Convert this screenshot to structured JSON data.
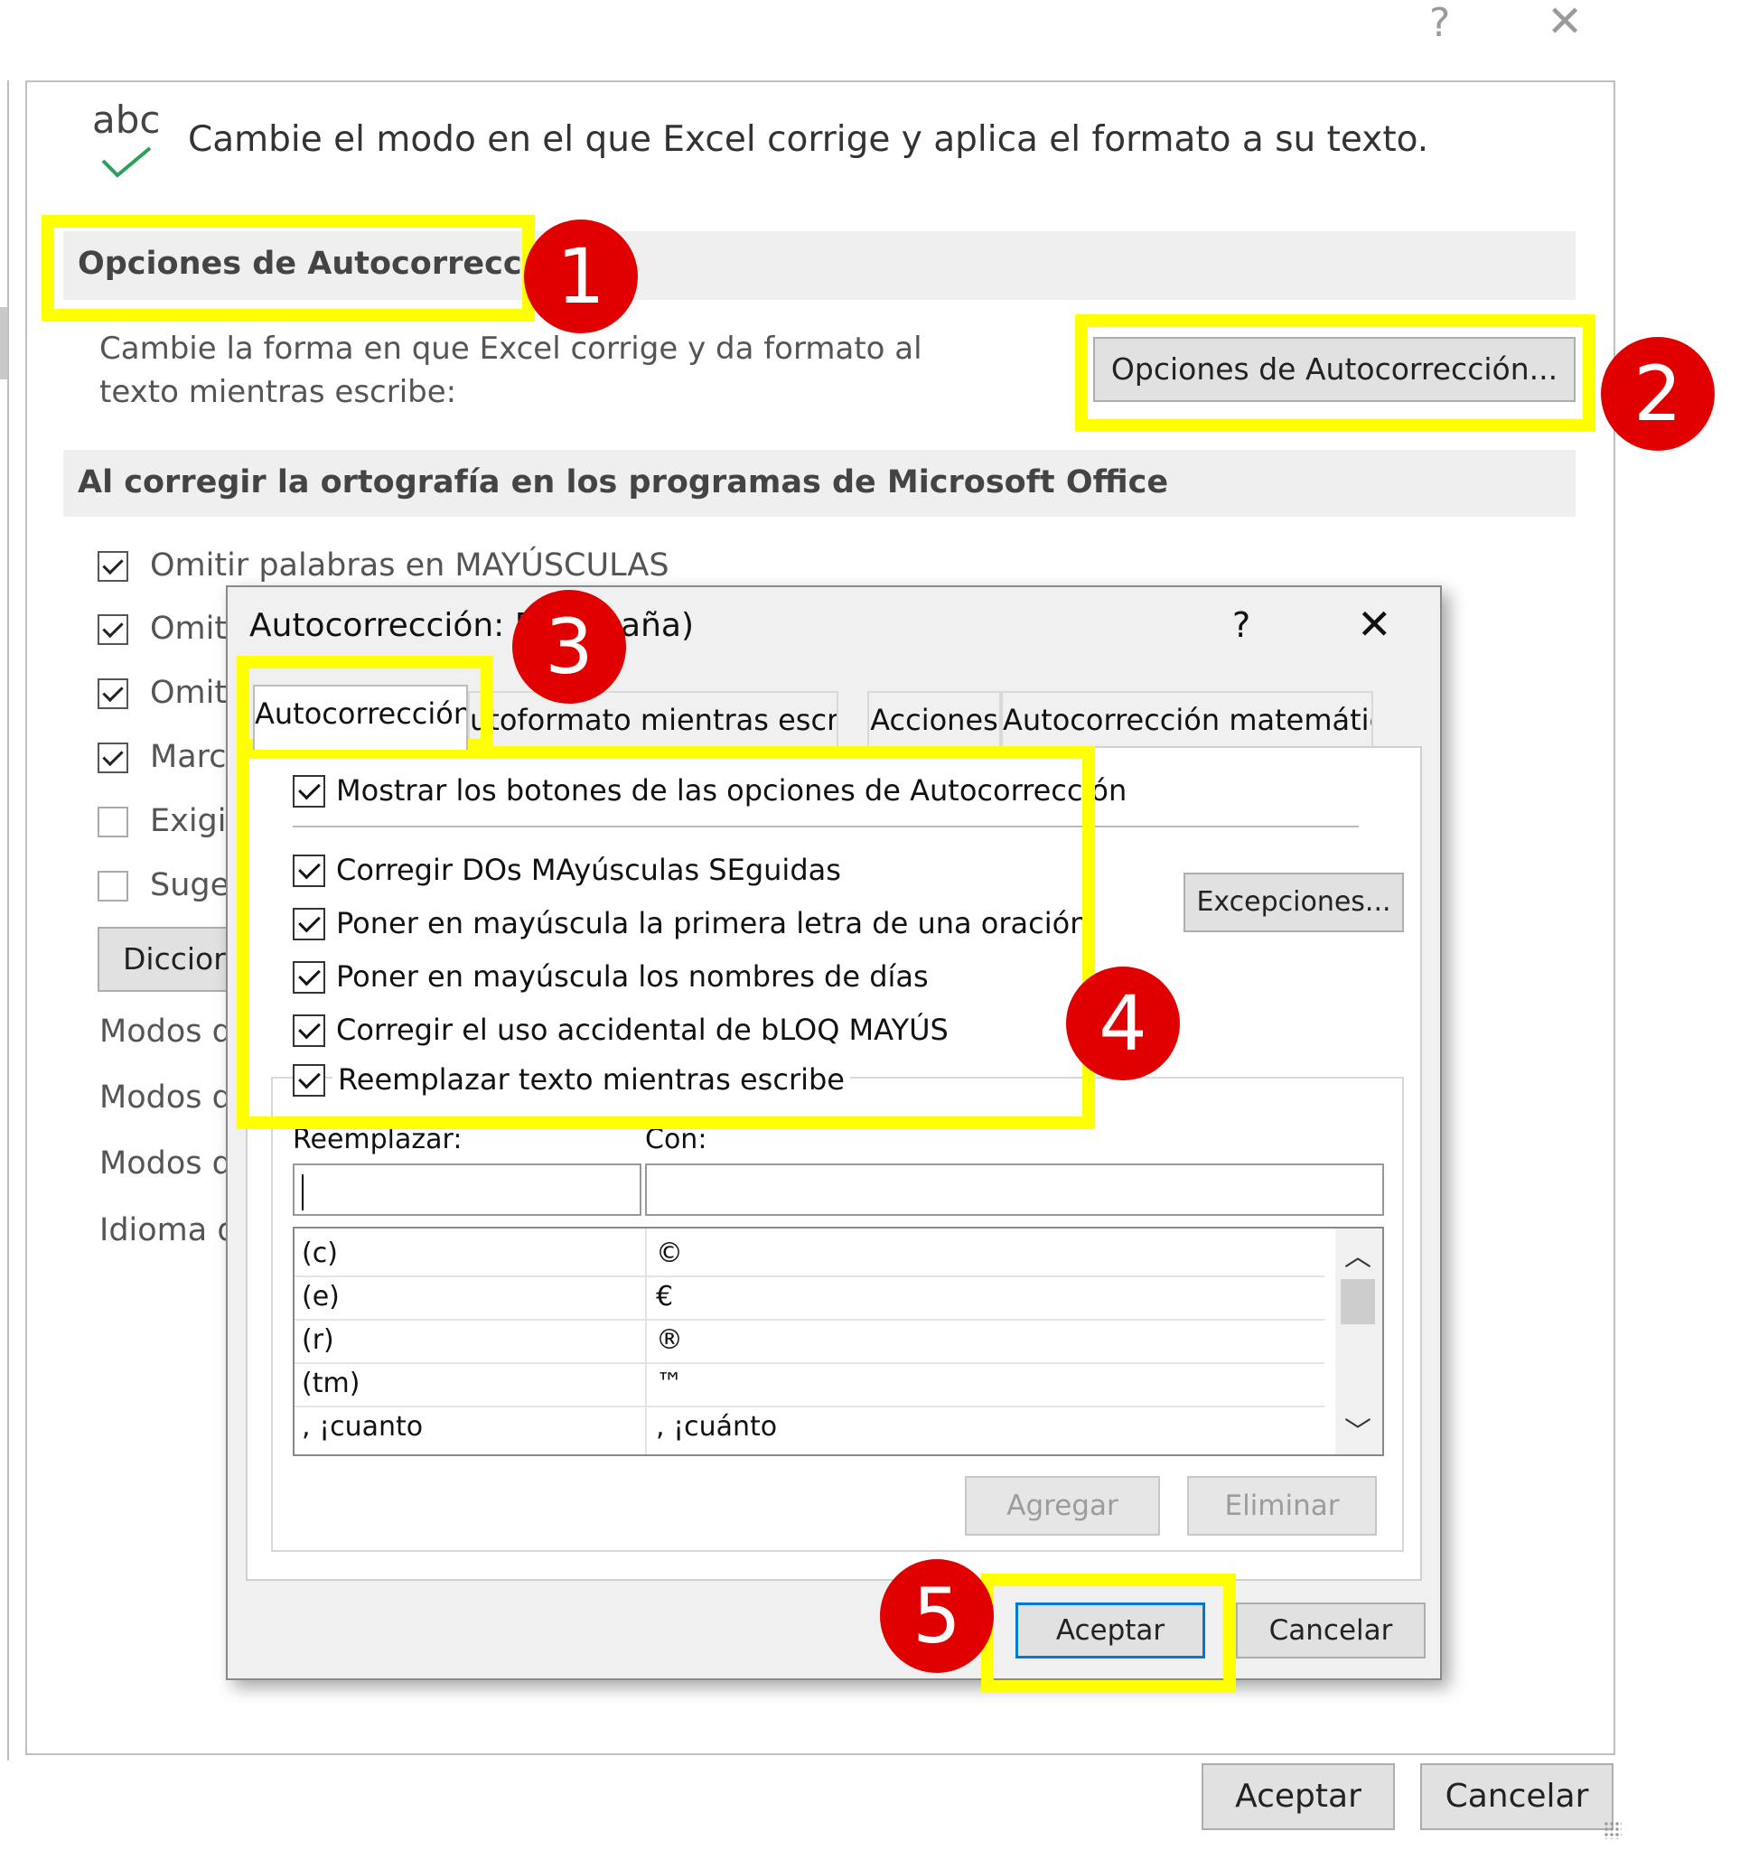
{
  "window": {
    "help_glyph": "?",
    "close_glyph": "✕"
  },
  "header": {
    "icon_text": "abc",
    "title": "Cambie el modo en el que Excel corrige y aplica el formato a su texto."
  },
  "autocorrect_section": {
    "heading": "Opciones de Autocorrección",
    "description": "Cambie la forma en que Excel corrige y da formato al texto mientras escribe:",
    "button_label": "Opciones de Autocorrección..."
  },
  "spelling_section": {
    "heading": "Al corregir la ortografía en los programas de Microsoft Office",
    "options": [
      {
        "label": "Omitir palabras en MAYÚSCULAS",
        "checked": true
      },
      {
        "label": "Omit",
        "checked": true
      },
      {
        "label": "Omit",
        "checked": true
      },
      {
        "label": "Marc",
        "checked": true
      },
      {
        "label": "Exigi",
        "checked": false
      },
      {
        "label": "Suge",
        "checked": false
      }
    ],
    "dictionary_button": "Diccior",
    "modes": [
      "Modos d",
      "Modos d",
      "Modos d",
      "Idioma d"
    ]
  },
  "dialog": {
    "title": "Autocorrección: Es     España)",
    "help_glyph": "?",
    "close_glyph": "✕",
    "tabs": [
      {
        "label": "Autocorrección",
        "active": true
      },
      {
        "label": "utoformato mientras escribe",
        "active": false
      },
      {
        "label": "Acciones",
        "active": false
      },
      {
        "label": "Autocorrección matemática",
        "active": false
      }
    ],
    "show_buttons": {
      "label": "Mostrar los botones de las opciones de Autocorrección",
      "checked": true
    },
    "options": [
      {
        "label": "Corregir DOs MAyúsculas SEguidas",
        "checked": true
      },
      {
        "label": "Poner en mayúscula la primera letra de una oración",
        "checked": true
      },
      {
        "label": "Poner en mayúscula los nombres de días",
        "checked": true
      },
      {
        "label": "Corregir el uso accidental de bLOQ MAYÚS",
        "checked": true
      }
    ],
    "exceptions_button": "Excepciones...",
    "replace_as_you_type": {
      "label": "Reemplazar texto mientras escribe",
      "checked": true
    },
    "replace_label": "Reemplazar:",
    "with_label": "Con:",
    "replace_value": "",
    "with_value": "",
    "list": [
      {
        "replace": "(c)",
        "with": "©"
      },
      {
        "replace": "(e)",
        "with": "€"
      },
      {
        "replace": "(r)",
        "with": "®"
      },
      {
        "replace": "(tm)",
        "with": "™"
      },
      {
        "replace": ", ¡cuanto",
        "with": ", ¡cuánto"
      }
    ],
    "scroll_up": "︿",
    "scroll_down": "﹀",
    "add_button": "Agregar",
    "delete_button": "Eliminar",
    "ok_button": "Aceptar",
    "cancel_button": "Cancelar"
  },
  "footer": {
    "ok_button": "Aceptar",
    "cancel_button": "Cancelar"
  },
  "annotations": [
    "1",
    "2",
    "3",
    "4",
    "5"
  ],
  "colors": {
    "highlight": "#ffff00",
    "badge": "#e00000",
    "accent": "#0078d7",
    "check_icon": "#2e9e5b"
  }
}
